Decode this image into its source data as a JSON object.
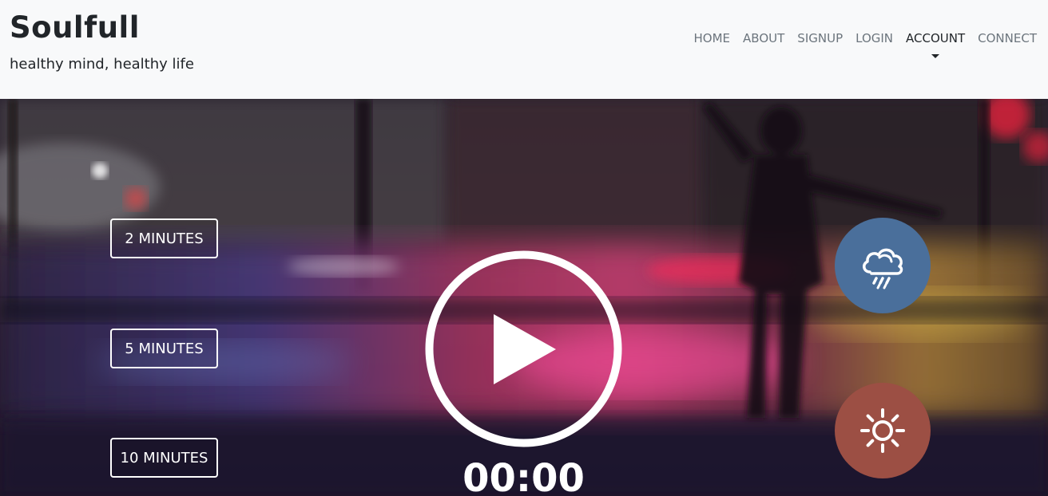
{
  "header": {
    "brand": "Soulfull",
    "tagline": "healthy mind, healthy life",
    "nav": [
      {
        "label": "HOME"
      },
      {
        "label": "ABOUT"
      },
      {
        "label": "SIGNUP"
      },
      {
        "label": "LOGIN"
      },
      {
        "label": "ACCOUNT"
      },
      {
        "label": "CONNECT"
      }
    ]
  },
  "hero": {
    "durations": [
      {
        "label": "2 MINUTES"
      },
      {
        "label": "5 MINUTES"
      },
      {
        "label": "10 MINUTES"
      }
    ],
    "timer": "00:00",
    "play_icon": "play-icon",
    "rain_icon": "cloud-rain-icon",
    "sun_icon": "sun-icon"
  },
  "colors": {
    "rain_button": "#4a6f9b",
    "sun_button": "#9c4f44",
    "header_bg": "#f8f9fa"
  }
}
